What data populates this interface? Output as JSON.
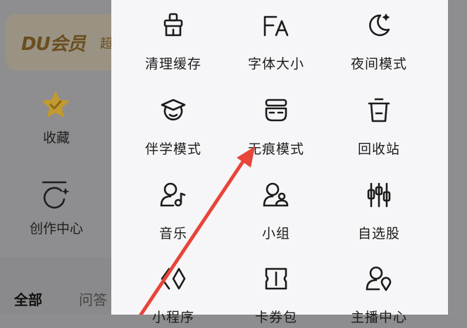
{
  "background": {
    "vip_logo": "DU会员",
    "vip_extra": "超",
    "favorites_label": "收藏",
    "creator_label": "创作中心",
    "tab_all": "全部",
    "tab_qa": "问答"
  },
  "tools": [
    {
      "label": "清理缓存",
      "icon": "broom-icon"
    },
    {
      "label": "字体大小",
      "icon": "font-size-icon"
    },
    {
      "label": "夜间模式",
      "icon": "moon-icon"
    },
    {
      "label": "伴学模式",
      "icon": "graduation-icon"
    },
    {
      "label": "无痕模式",
      "icon": "mask-icon"
    },
    {
      "label": "回收站",
      "icon": "trash-icon"
    },
    {
      "label": "音乐",
      "icon": "music-person-icon"
    },
    {
      "label": "小组",
      "icon": "group-icon"
    },
    {
      "label": "自选股",
      "icon": "stock-icon"
    },
    {
      "label": "小程序",
      "icon": "mini-program-icon"
    },
    {
      "label": "卡券包",
      "icon": "coupon-icon"
    },
    {
      "label": "主播中心",
      "icon": "anchor-icon"
    }
  ],
  "colors": {
    "arrow": "#e8443a",
    "star": "#e2a516",
    "panel": "#f6f6f8"
  }
}
